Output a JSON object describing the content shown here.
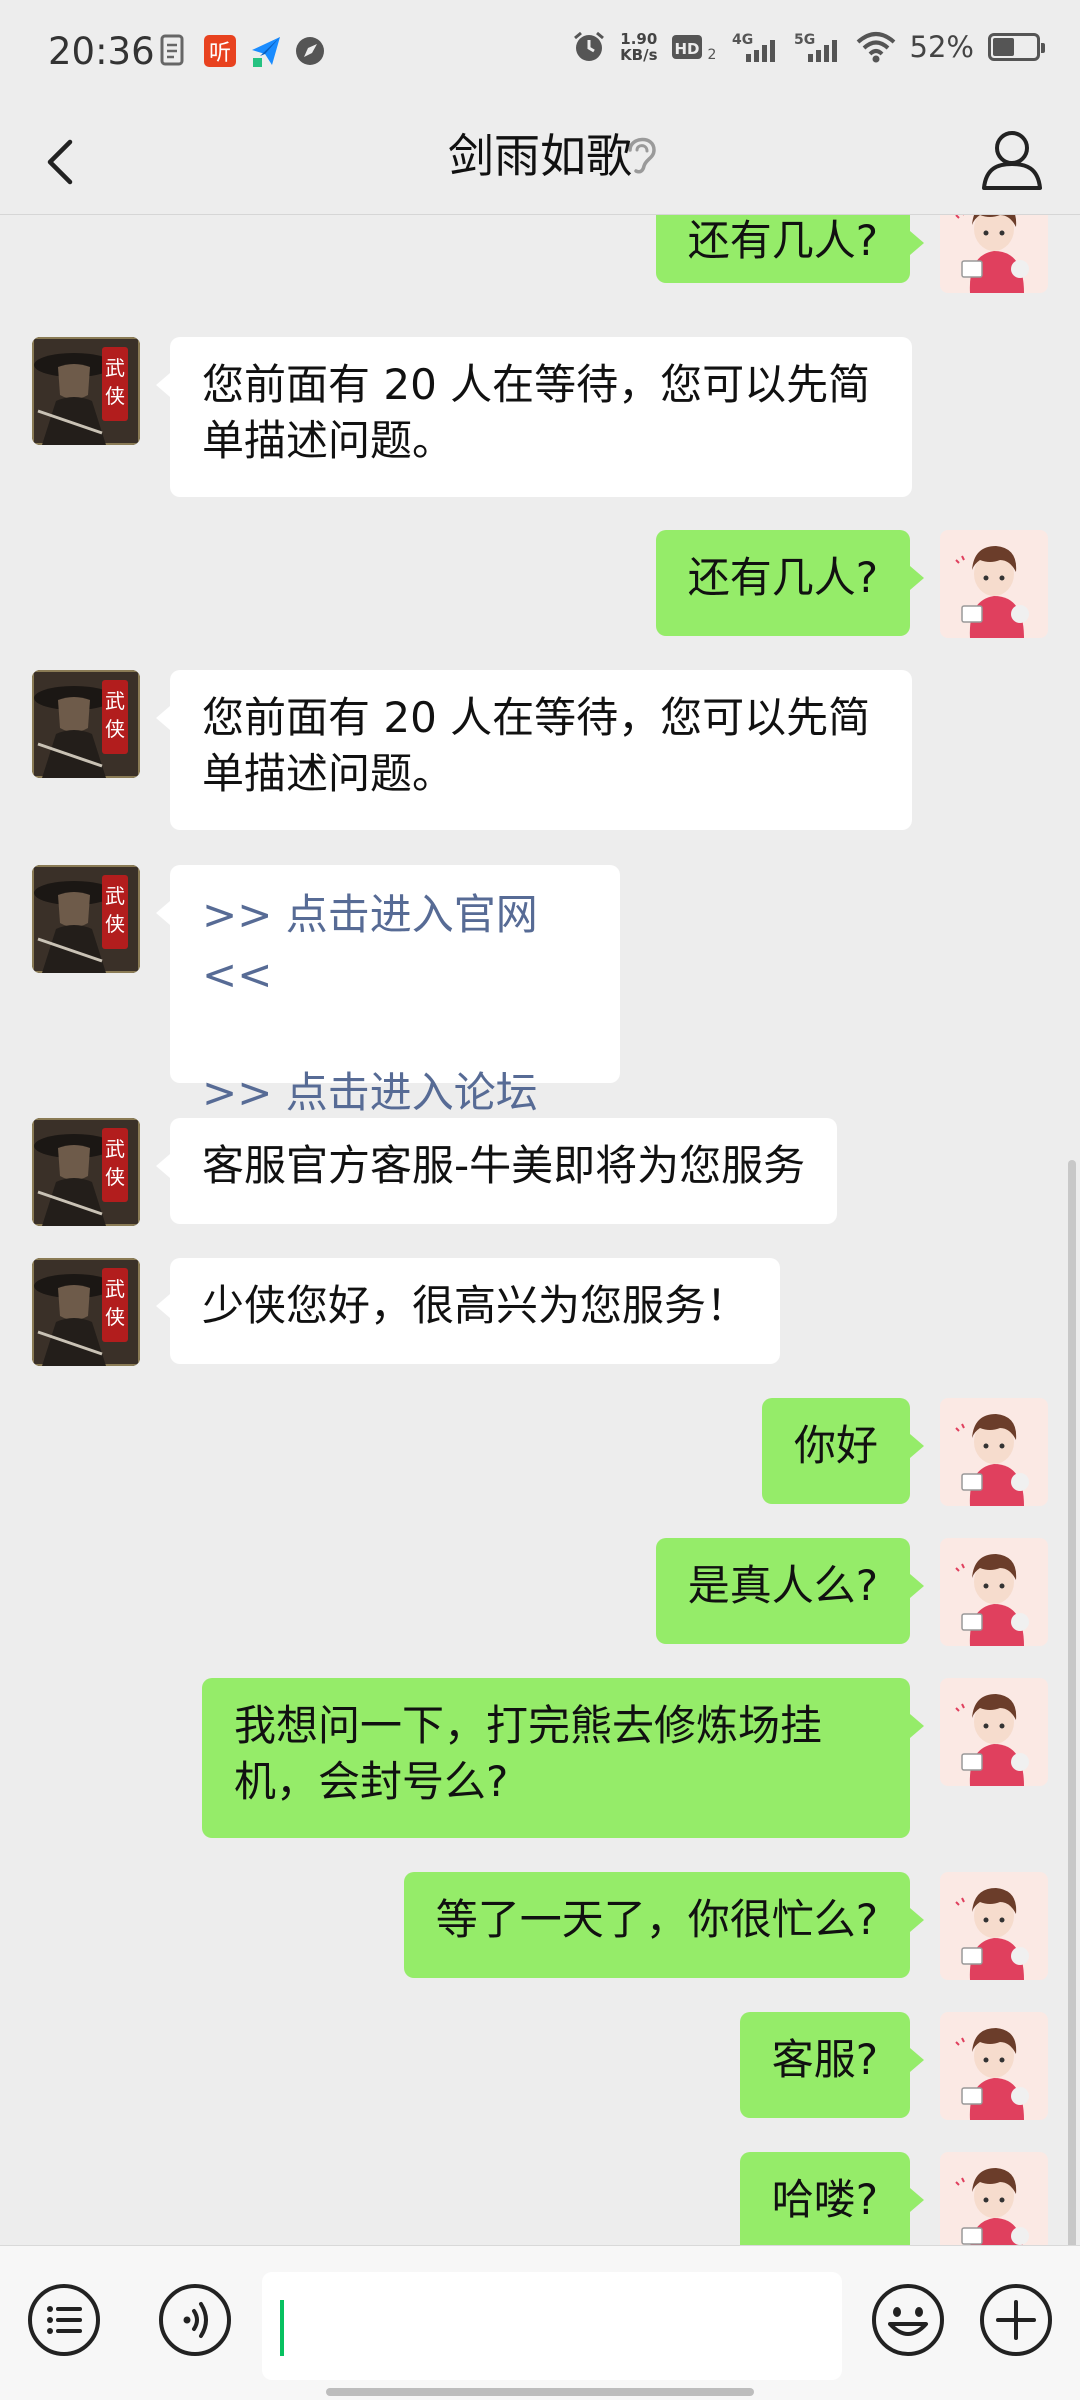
{
  "status_bar": {
    "time": "20:36",
    "net_speed_value": "1.90",
    "net_speed_unit": "KB/s",
    "hd_label": "HD",
    "hd_index": "2",
    "sig1_label": "4G",
    "sig2_label": "5G",
    "battery_text": "52%",
    "battery_level": 0.52,
    "left_icons": [
      "document-icon",
      "ting-app-icon",
      "paper-plane-icon",
      "compass-icon"
    ],
    "right_icons": [
      "alarm-icon",
      "hd-icon",
      "signal-4g-icon",
      "signal-5g-icon",
      "wifi-icon",
      "battery-icon"
    ],
    "ting_label": "听"
  },
  "header": {
    "title": "剑雨如歌",
    "icons": [
      "back-icon",
      "ear-icon",
      "profile-icon"
    ]
  },
  "messages": [
    {
      "side": "right",
      "text": "还有几人?"
    },
    {
      "side": "left",
      "text": "您前面有 20 人在等待，您可以先简单描述问题。"
    },
    {
      "side": "right",
      "text": "还有几人?"
    },
    {
      "side": "left",
      "text": "您前面有 20 人在等待，您可以先简单描述问题。"
    },
    {
      "side": "left",
      "links": [
        ">> 点击进入官网 <<",
        ">> 点击进入论坛 <<"
      ]
    },
    {
      "side": "left",
      "text": "客服官方客服-牛美即将为您服务"
    },
    {
      "side": "left",
      "text": "少侠您好，很高兴为您服务！"
    },
    {
      "side": "right",
      "text": "你好"
    },
    {
      "side": "right",
      "text": "是真人么?"
    },
    {
      "side": "right",
      "text": "我想问一下，打完熊去修炼场挂机，会封号么?"
    },
    {
      "side": "right",
      "text": "等了一天了，你很忙么?"
    },
    {
      "side": "right",
      "text": "客服?"
    },
    {
      "side": "right",
      "text": "哈喽?"
    }
  ],
  "avatar_badge": "武侠",
  "input_bar": {
    "input_value": "",
    "icons": [
      "menu-list-icon",
      "voice-icon",
      "emoji-icon",
      "plus-icon"
    ]
  },
  "colors": {
    "sent_bubble": "#95ec69",
    "received_bubble": "#ffffff",
    "background": "#ededed",
    "link": "#576b95"
  }
}
